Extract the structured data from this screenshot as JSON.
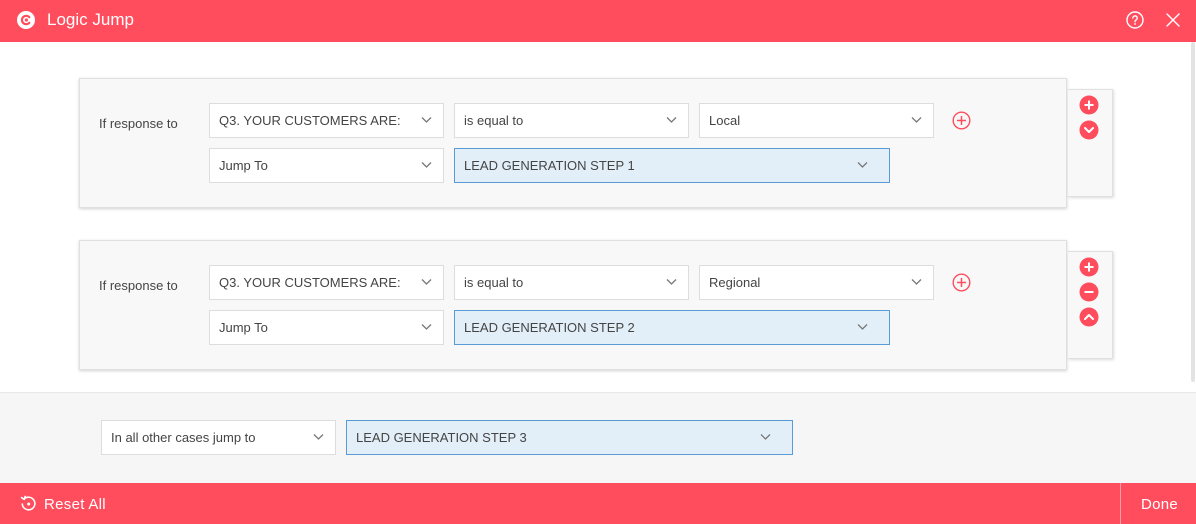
{
  "header": {
    "title": "Logic Jump",
    "logo_icon": "logo-c-icon",
    "help_icon": "help-circle-icon",
    "close_icon": "close-icon"
  },
  "rules": [
    {
      "if_label": "If response to",
      "question": "Q3. YOUR CUSTOMERS ARE:",
      "condition": "is equal to",
      "value": "Local",
      "action": "Jump To",
      "target": "LEAD GENERATION STEP 1"
    },
    {
      "if_label": "If response to",
      "question": "Q3. YOUR CUSTOMERS ARE:",
      "condition": "is equal to",
      "value": "Regional",
      "action": "Jump To",
      "target": "LEAD GENERATION STEP 2"
    }
  ],
  "default_rule": {
    "label": "In all other cases jump to",
    "target": "LEAD GENERATION STEP 3"
  },
  "footer": {
    "reset_label": "Reset All",
    "done_label": "Done"
  },
  "colors": {
    "brand": "#ff4d5e",
    "selected_bg": "#e3eff8",
    "selected_border": "#5b9bd5"
  }
}
